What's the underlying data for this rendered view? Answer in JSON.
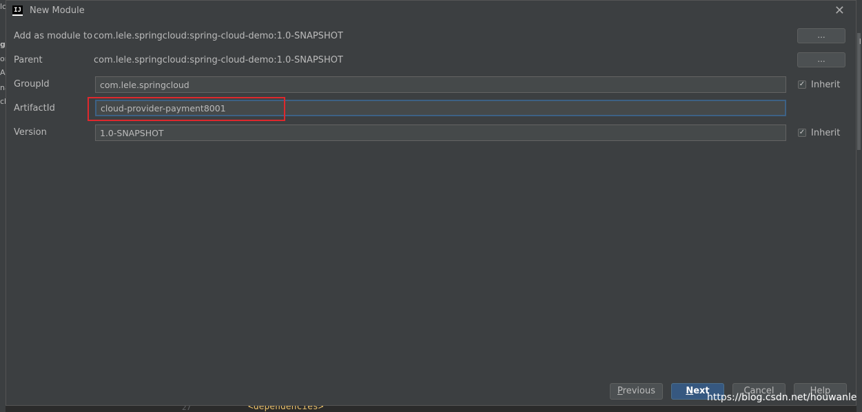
{
  "background": {
    "left_fragments": [
      "lc",
      "g",
      "or",
      "A",
      "na",
      "ch"
    ],
    "right_fragment": "I",
    "code_text": "<dependencies>",
    "gutter_text": "27"
  },
  "dialog": {
    "title": "New Module",
    "app_icon_text": "IJ",
    "close_glyph": "✕"
  },
  "form": {
    "add_as_module_label": "Add as module to",
    "add_as_module_value": "com.lele.springcloud:spring-cloud-demo:1.0-SNAPSHOT",
    "parent_label": "Parent",
    "parent_value": "com.lele.springcloud:spring-cloud-demo:1.0-SNAPSHOT",
    "browse_label": "...",
    "groupid_label": "GroupId",
    "groupid_value": "com.lele.springcloud",
    "artifactid_label": "ArtifactId",
    "artifactid_value": "cloud-provider-payment8001",
    "version_label": "Version",
    "version_value": "1.0-SNAPSHOT",
    "inherit_label": "Inherit",
    "groupid_inherit_checked": true,
    "version_inherit_checked": true,
    "check_glyph": "✓"
  },
  "buttons": {
    "previous_first": "P",
    "previous_rest": "revious",
    "next_first": "N",
    "next_rest": "ext",
    "cancel": "Cancel",
    "help": "Help"
  },
  "watermark": "https://blog.csdn.net/houwanle",
  "colors": {
    "dialog_bg": "#3c3f41",
    "field_bg": "#45494a",
    "focus_border": "#3d6185",
    "highlight_box": "#e0282d",
    "primary_button": "#365880"
  }
}
